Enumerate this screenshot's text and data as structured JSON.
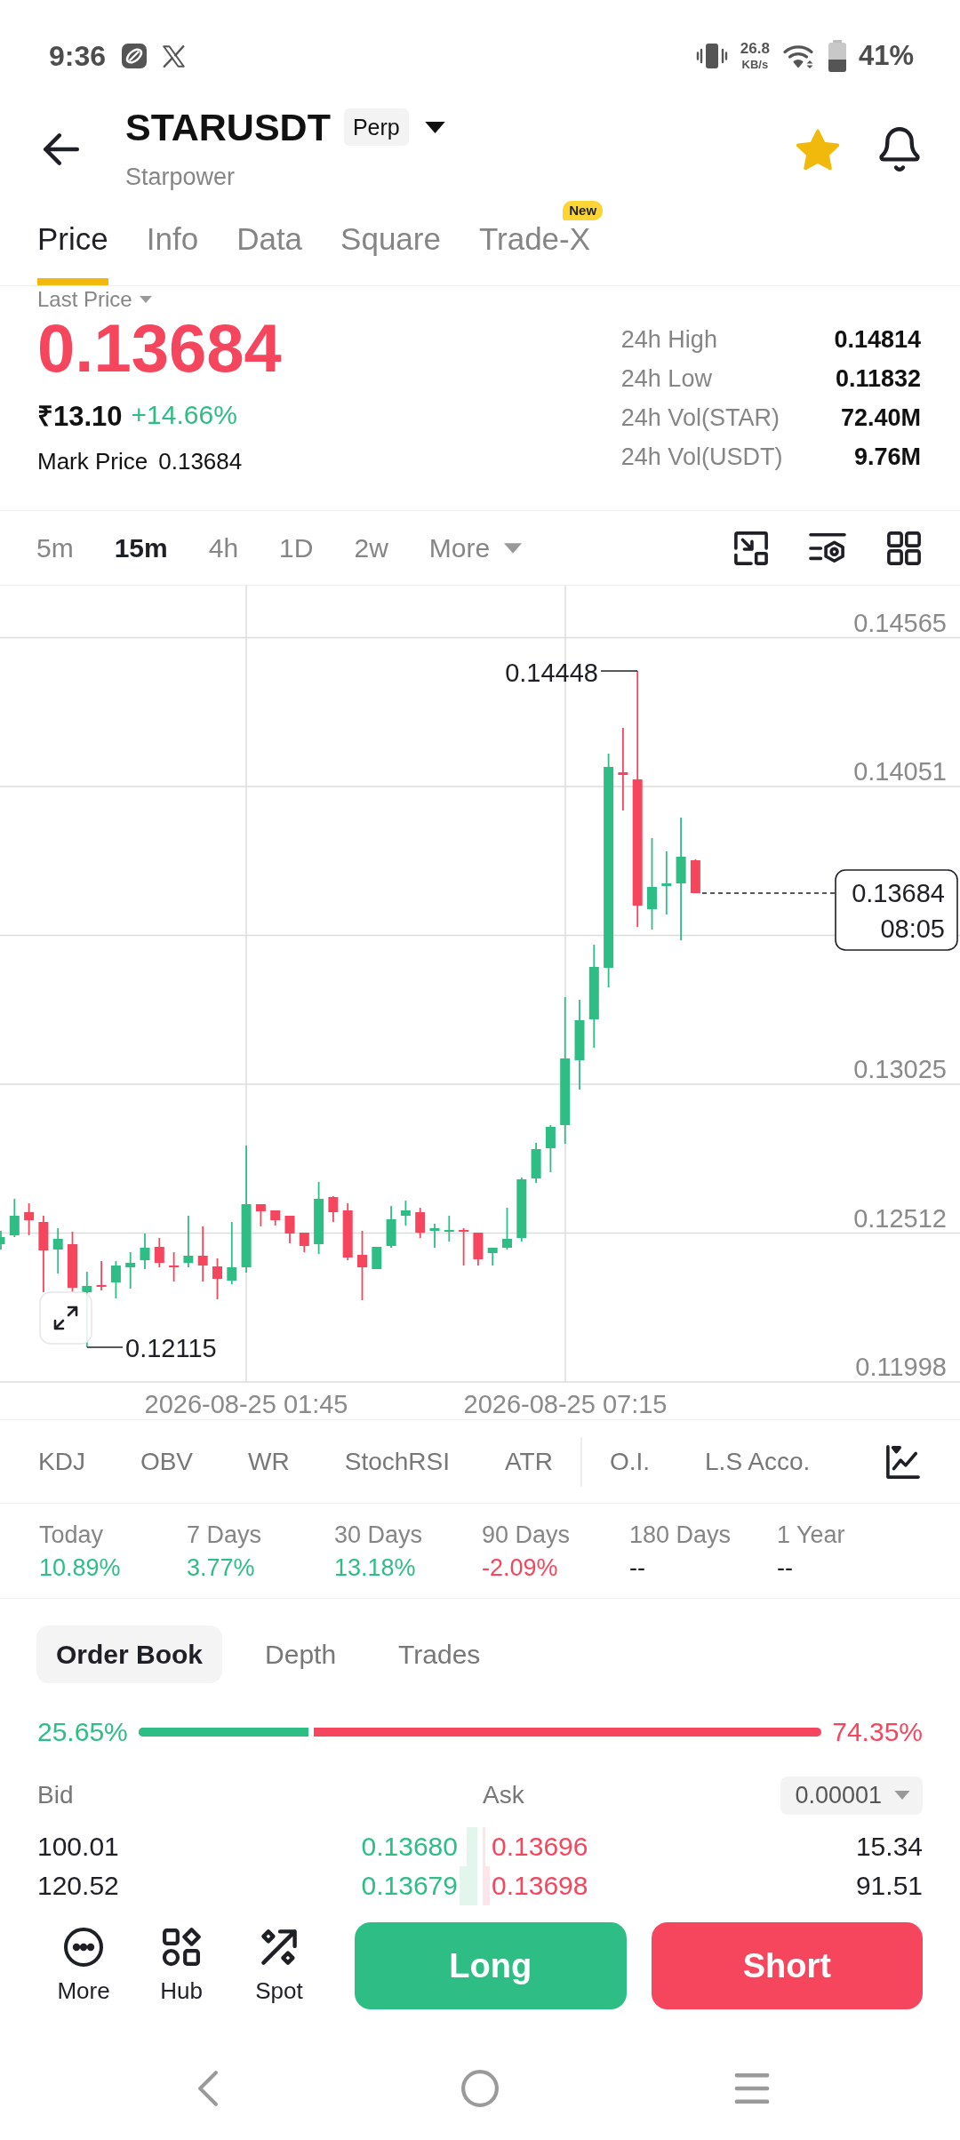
{
  "status_bar": {
    "time": "9:36",
    "speed_value": "26.8",
    "speed_unit": "KB/s",
    "battery": "41%"
  },
  "header": {
    "symbol": "STARUSDT",
    "badge": "Perp",
    "name": "Starpower",
    "favorite": true
  },
  "tabs": [
    {
      "label": "Price",
      "selected": true
    },
    {
      "label": "Info",
      "selected": false
    },
    {
      "label": "Data",
      "selected": false
    },
    {
      "label": "Square",
      "selected": false
    },
    {
      "label": "Trade-X",
      "selected": false,
      "badge": "New"
    }
  ],
  "price_panel": {
    "price_type": "Last Price",
    "last_price": "0.13684",
    "fiat_price": "₹13.10",
    "change": "+14.66%",
    "mark_price_label": "Mark Price",
    "mark_price": "0.13684",
    "stats": [
      {
        "label": "24h High",
        "value": "0.14814"
      },
      {
        "label": "24h Low",
        "value": "0.11832"
      },
      {
        "label": "24h Vol(STAR)",
        "value": "72.40M"
      },
      {
        "label": "24h Vol(USDT)",
        "value": "9.76M"
      }
    ]
  },
  "intervals": [
    {
      "label": "5m",
      "selected": false
    },
    {
      "label": "15m",
      "selected": true
    },
    {
      "label": "4h",
      "selected": false
    },
    {
      "label": "1D",
      "selected": false
    },
    {
      "label": "2w",
      "selected": false
    }
  ],
  "more_intervals": "More",
  "chart": {
    "y_axis_labels": [
      "0.14565",
      "0.14051",
      "0.13025",
      "0.12512",
      "0.11998"
    ],
    "x_axis_labels": [
      "2026-08-25 01:45",
      "2026-08-25 07:15"
    ],
    "high_label": "0.14448",
    "low_label": "0.12115",
    "current_price": "0.13684",
    "countdown": "08:05"
  },
  "indicators": [
    "KDJ",
    "OBV",
    "WR",
    "StochRSI",
    "ATR"
  ],
  "data_indicators": [
    "O.I.",
    "L.S Acco."
  ],
  "performance": [
    {
      "period": "Today",
      "change": "10.89%",
      "color": "#2ebd85"
    },
    {
      "period": "7 Days",
      "change": "3.77%",
      "color": "#2ebd85"
    },
    {
      "period": "30 Days",
      "change": "13.18%",
      "color": "#2ebd85"
    },
    {
      "period": "90 Days",
      "change": "-2.09%",
      "color": "#f6465d"
    },
    {
      "period": "180 Days",
      "change": "--",
      "color": "#1e2026"
    },
    {
      "period": "1 Year",
      "change": "--",
      "color": "#1e2026"
    }
  ],
  "order_book": {
    "tabs": [
      {
        "label": "Order Book",
        "selected": true
      },
      {
        "label": "Depth",
        "selected": false
      },
      {
        "label": "Trades",
        "selected": false
      }
    ],
    "buy_share": "25.65%",
    "sell_share": "74.35%",
    "level": 0.2565,
    "bid_header": "Bid",
    "ask_header": "Ask",
    "precision": "0.00001",
    "rows": [
      {
        "bid": {
          "qty": "100.01",
          "price": "0.13680"
        },
        "ask": {
          "price": "0.13696",
          "qty": "15.34"
        }
      },
      {
        "bid": {
          "qty": "120.52",
          "price": "0.13679"
        },
        "ask": {
          "price": "0.13698",
          "qty": "91.51"
        }
      }
    ]
  },
  "actions": [
    {
      "label": "More",
      "kind": "more"
    },
    {
      "label": "Hub",
      "kind": "hub"
    },
    {
      "label": "Spot",
      "kind": "spot"
    }
  ],
  "trade_buttons": [
    {
      "label": "Long",
      "kind": "long"
    },
    {
      "label": "Short",
      "kind": "short"
    }
  ]
}
